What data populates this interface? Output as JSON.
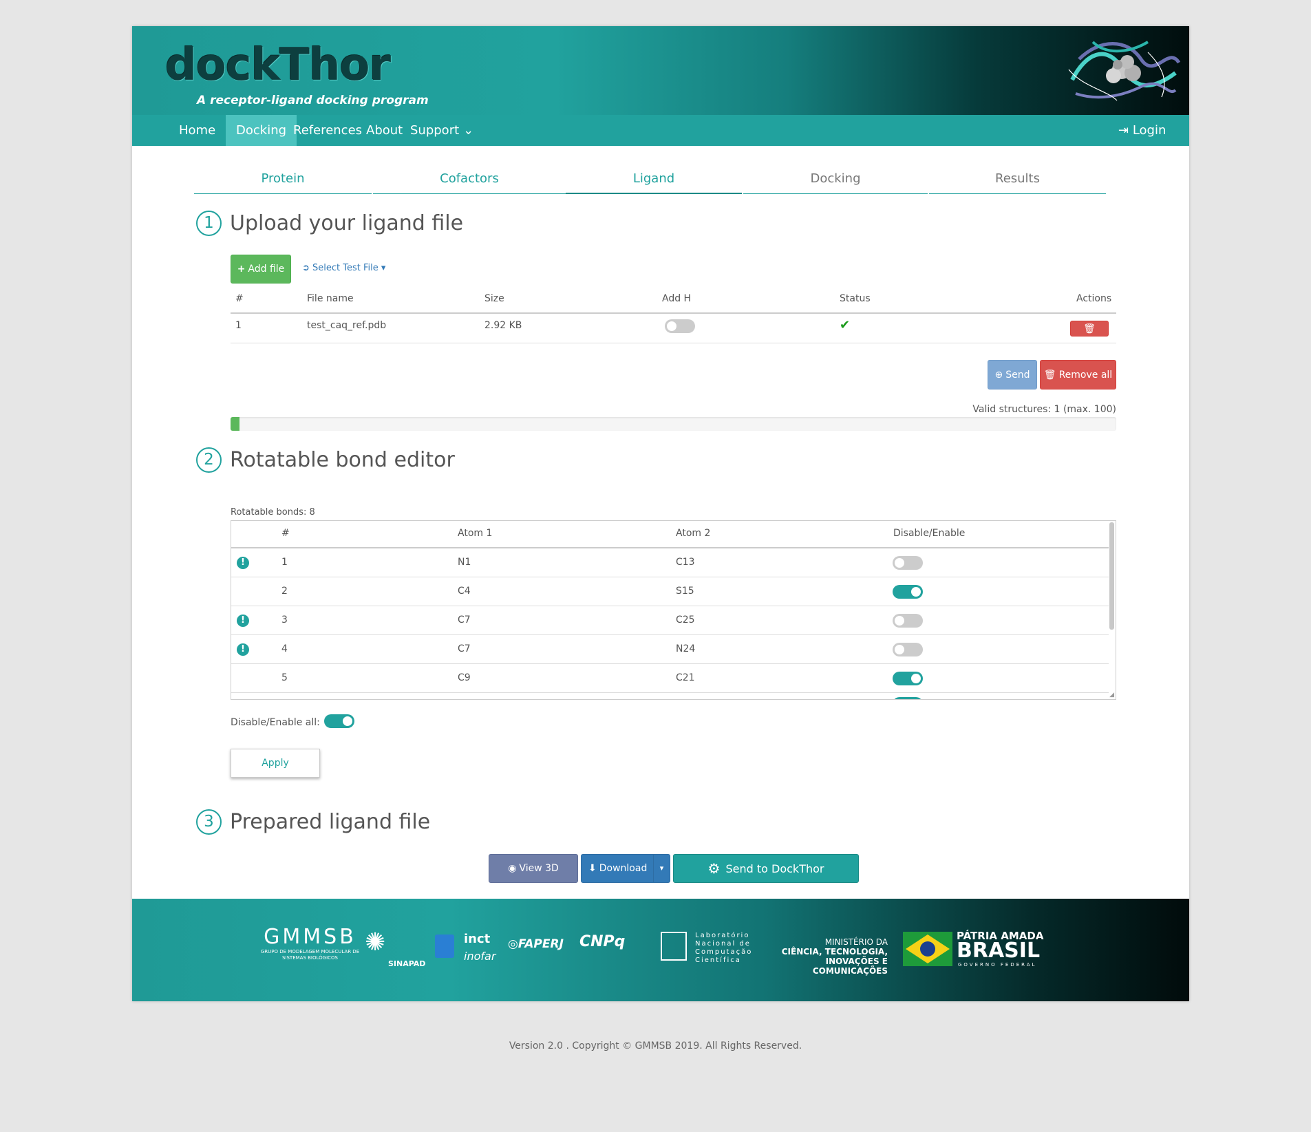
{
  "header": {
    "logo_word": "dockThor",
    "logo_tagline": "A receptor-ligand docking program"
  },
  "nav": {
    "items": [
      "Home",
      "Docking",
      "References",
      "About",
      "Support"
    ],
    "active": "Docking",
    "login": "Login"
  },
  "tabs": [
    "Protein",
    "Cofactors",
    "Ligand",
    "Docking",
    "Results"
  ],
  "active_tab": "Ligand",
  "section1": {
    "number": "1",
    "title": "Upload your ligand file",
    "add_file": "Add file",
    "select_test": "Select Test File",
    "table_headers": [
      "#",
      "File name",
      "Size",
      "Add H",
      "Status",
      "Actions"
    ],
    "rows": [
      {
        "num": "1",
        "file": "test_caq_ref.pdb",
        "size": "2.92 KB",
        "add_h": false,
        "status": "ok"
      }
    ],
    "send": "Send",
    "remove_all": "Remove all",
    "valid_structures": "Valid structures: 1 (max. 100)",
    "progress_fraction": 0.01
  },
  "section2": {
    "number": "2",
    "title": "Rotatable bond editor",
    "bonds_label": "Rotatable bonds: 8",
    "headers": [
      "#",
      "Atom 1",
      "Atom 2",
      "Disable/Enable"
    ],
    "rows": [
      {
        "warn": true,
        "num": "1",
        "atom1": "N1",
        "atom2": "C13",
        "enabled": false
      },
      {
        "warn": false,
        "num": "2",
        "atom1": "C4",
        "atom2": "S15",
        "enabled": true
      },
      {
        "warn": true,
        "num": "3",
        "atom1": "C7",
        "atom2": "C25",
        "enabled": false
      },
      {
        "warn": true,
        "num": "4",
        "atom1": "C7",
        "atom2": "N24",
        "enabled": false
      },
      {
        "warn": false,
        "num": "5",
        "atom1": "C9",
        "atom2": "C21",
        "enabled": true
      }
    ],
    "enable_all_label": "Disable/Enable all:",
    "apply": "Apply"
  },
  "section3": {
    "number": "3",
    "title": "Prepared ligand file",
    "view3d": "View 3D",
    "download": "Download",
    "send_dockthor": "Send to DockThor"
  },
  "footer": {
    "gmmsb": "GMMSB",
    "gmmsb_sub": "GRUPO DE MODELAGEM MOLECULAR DE SISTEMAS BIOLÓGICOS",
    "sinapad": "SINAPAD",
    "inct": "inct",
    "inct_sub": "inofar",
    "faperj": "FAPERJ",
    "cnpq": "CNPq",
    "lncc": "Laboratório Nacional de Computação Científica",
    "ministerio_1": "MINISTÉRIO DA",
    "ministerio_2": "CIÊNCIA, TECNOLOGIA,",
    "ministerio_3": "INOVAÇÕES E COMUNICAÇÕES",
    "patria": "PÁTRIA AMADA",
    "brasil": "BRASIL",
    "governo": "GOVERNO FEDERAL"
  },
  "copyright": "Version 2.0 . Copyright © GMMSB 2019. All Rights Reserved.",
  "colors": {
    "teal": "#21a29e",
    "active_nav": "#4cc3bf",
    "green": "#5cb85c",
    "red": "#d9534f"
  }
}
